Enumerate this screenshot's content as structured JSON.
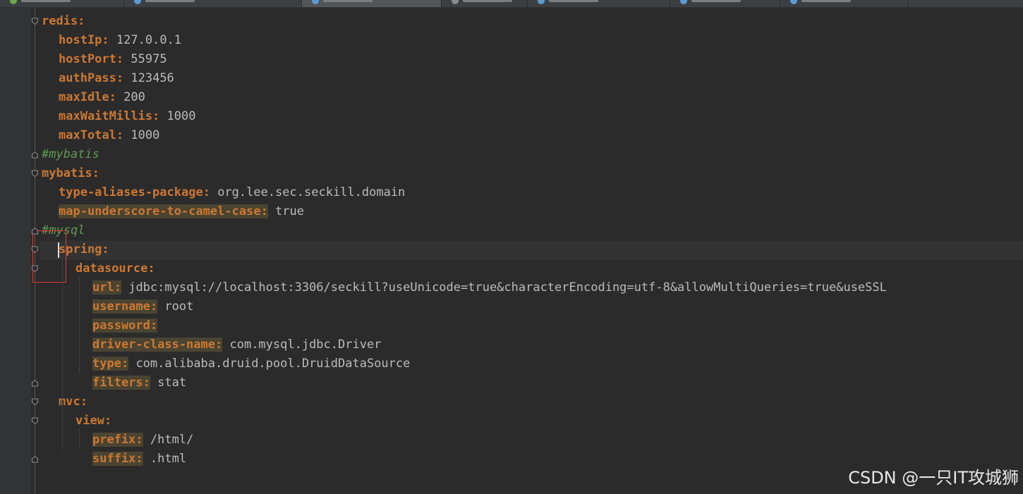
{
  "editor": {
    "tabs": [
      {
        "icon": "green-dot-icon"
      },
      {
        "icon": "gear-icon"
      },
      {
        "icon": "gear-icon",
        "active": true
      },
      {
        "icon": "gray-icon"
      },
      {
        "icon": "blue-circle-icon"
      },
      {
        "icon": "blue-circle-icon"
      },
      {
        "icon": "blue-circle-icon"
      }
    ],
    "lines": [
      {
        "indent": 0,
        "key": "redis",
        "value": ""
      },
      {
        "indent": 1,
        "key": "hostIp",
        "value": "127.0.0.1"
      },
      {
        "indent": 1,
        "key": "hostPort",
        "value": "55975"
      },
      {
        "indent": 1,
        "key": "authPass",
        "value": "123456"
      },
      {
        "indent": 1,
        "key": "maxIdle",
        "value": "200"
      },
      {
        "indent": 1,
        "key": "maxWaitMillis",
        "value": "1000"
      },
      {
        "indent": 1,
        "key": "maxTotal",
        "value": "1000"
      },
      {
        "indent": 0,
        "comment": "#mybatis"
      },
      {
        "indent": 0,
        "key": "mybatis",
        "value": ""
      },
      {
        "indent": 1,
        "key": "type-aliases-package",
        "value": "org.lee.sec.seckill.domain"
      },
      {
        "indent": 1,
        "key": "map-underscore-to-camel-case",
        "value": "true",
        "highlight": true
      },
      {
        "indent": 0,
        "comment": "#mysql"
      },
      {
        "indent": 1,
        "key": "spring",
        "value": ""
      },
      {
        "indent": 2,
        "key": "datasource",
        "value": ""
      },
      {
        "indent": 3,
        "key": "url",
        "value": "jdbc:mysql://localhost:3306/seckill?useUnicode=true&characterEncoding=utf-8&allowMultiQueries=true&useSSL",
        "highlight": true
      },
      {
        "indent": 3,
        "key": "username",
        "value": "root",
        "highlight": true
      },
      {
        "indent": 3,
        "key": "password",
        "value": "",
        "highlight": true
      },
      {
        "indent": 3,
        "key": "driver-class-name",
        "value": "com.mysql.jdbc.Driver",
        "highlight": true
      },
      {
        "indent": 3,
        "key": "type",
        "value": "com.alibaba.druid.pool.DruidDataSource",
        "highlight": true
      },
      {
        "indent": 3,
        "key": "filters",
        "value": "stat",
        "highlight": true
      },
      {
        "indent": 1,
        "key": "mvc",
        "value": ""
      },
      {
        "indent": 2,
        "key": "view",
        "value": ""
      },
      {
        "indent": 3,
        "key": "prefix",
        "value": "/html/",
        "highlight": true
      },
      {
        "indent": 3,
        "key": "suffix",
        "value": ".html",
        "highlight": true
      }
    ]
  },
  "watermark": "CSDN @一只IT攻城狮",
  "colors": {
    "background": "#2b2b2b",
    "key": "#cc7832",
    "value": "#bbbbbb",
    "comment": "#629755",
    "annotation": "#e53935"
  }
}
